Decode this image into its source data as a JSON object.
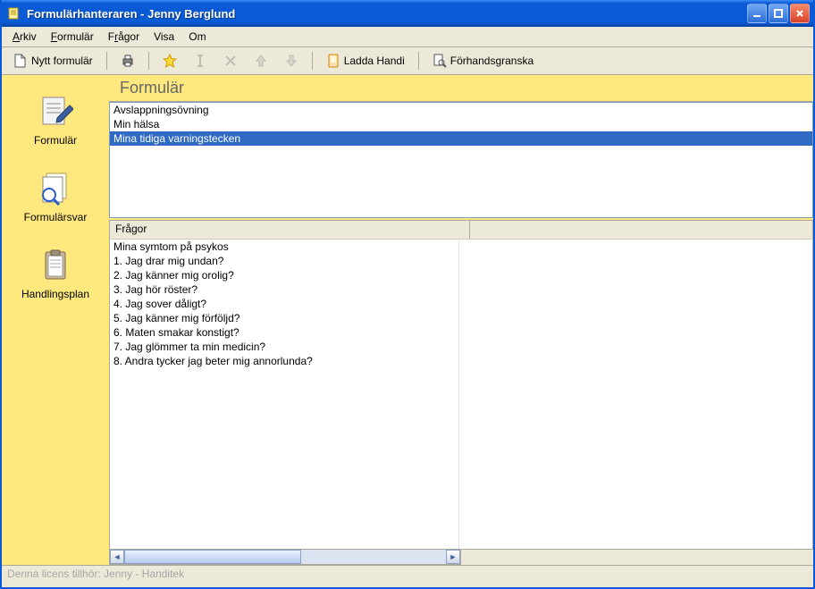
{
  "window": {
    "title": "Formulärhanteraren - Jenny Berglund"
  },
  "menu": {
    "items": [
      "Arkiv",
      "Formulär",
      "Frågor",
      "Visa",
      "Om"
    ]
  },
  "toolbar": {
    "new_form": "Nytt formulär",
    "ladda_handi": "Ladda Handi",
    "preview": "Förhandsgranska"
  },
  "sidebar": {
    "items": [
      {
        "label": "Formulär"
      },
      {
        "label": "Formulärsvar"
      },
      {
        "label": "Handlingsplan"
      }
    ]
  },
  "forms": {
    "heading": "Formulär",
    "items": [
      {
        "label": "Avslappningsövning",
        "selected": false
      },
      {
        "label": "Min hälsa",
        "selected": false
      },
      {
        "label": "Mina tidiga varningstecken",
        "selected": true
      }
    ]
  },
  "questions": {
    "heading": "Frågor",
    "items": [
      "Mina symtom på psykos",
      "1. Jag drar mig undan?",
      "2. Jag känner mig orolig?",
      "3. Jag hör röster?",
      "4. Jag sover dåligt?",
      "5. Jag känner mig förföljd?",
      "6. Maten smakar konstigt?",
      "7. Jag glömmer ta min medicin?",
      "8. Andra tycker jag beter mig annorlunda?"
    ]
  },
  "status": {
    "text": "Denna licens tillhör: Jenny - Handitek"
  }
}
